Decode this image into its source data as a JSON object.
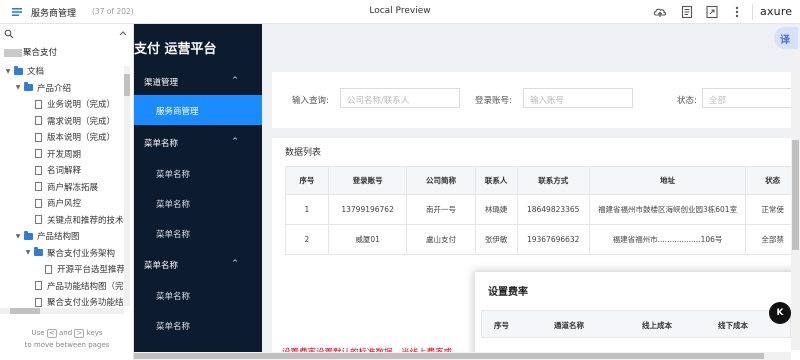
{
  "topbar": {
    "page_title": "服务商管理",
    "page_count": "(37 of 202)",
    "center_title": "Local Preview",
    "brand": "axure",
    "icons": [
      "menu-icon",
      "share-icon",
      "notes-icon",
      "expand-icon",
      "more-icon"
    ]
  },
  "sitemap": {
    "root_label": "聚合支付",
    "rows": [
      {
        "label": "文档",
        "type": "folder",
        "indent": 0,
        "open": true
      },
      {
        "label": "产品介绍",
        "type": "folder",
        "indent": 1,
        "open": true
      },
      {
        "label": "业务说明（完成）",
        "type": "page",
        "indent": 2
      },
      {
        "label": "需求说明（完成）",
        "type": "page",
        "indent": 2
      },
      {
        "label": "版本说明（完成）",
        "type": "page",
        "indent": 2
      },
      {
        "label": "开发周期",
        "type": "page",
        "indent": 2
      },
      {
        "label": "名词解释",
        "type": "page",
        "indent": 2
      },
      {
        "label": "商户解冻拓展",
        "type": "page",
        "indent": 2
      },
      {
        "label": "商户风控",
        "type": "page",
        "indent": 2
      },
      {
        "label": "关键点和推荐的技术",
        "type": "page",
        "indent": 2
      },
      {
        "label": "产品结构图",
        "type": "folder",
        "indent": 1,
        "open": true
      },
      {
        "label": "聚合支付业务架构",
        "type": "folder",
        "indent": 2,
        "open": true
      },
      {
        "label": "开源平台选型推荐",
        "type": "page",
        "indent": 3
      },
      {
        "label": "产品功能结构图（完",
        "type": "page",
        "indent": 2
      },
      {
        "label": "聚合支付业务功能结",
        "type": "page",
        "indent": 2
      }
    ],
    "help_line1_a": "Use",
    "help_key_left": "<",
    "help_line1_b": "and",
    "help_key_right": ">",
    "help_line1_c": "keys",
    "help_line2": "to move between pages"
  },
  "nav": {
    "app_title": "支付 运营平台",
    "groups": [
      {
        "label": "渠道管理",
        "caret": "^"
      },
      {
        "label": "菜单名称",
        "caret": "^"
      },
      {
        "label": "菜单名称",
        "caret": "^"
      }
    ],
    "active_item": "服务商管理",
    "items_group2": [
      "菜单名称",
      "菜单名称",
      "菜单名称"
    ],
    "items_group3": [
      "菜单名称",
      "菜单名称"
    ]
  },
  "filter": {
    "query_label": "输入查询:",
    "query_placeholder": "公司名称/联系人",
    "account_label": "登录账号:",
    "account_placeholder": "输入账号",
    "status_label": "状态:",
    "status_value": "全部"
  },
  "list": {
    "title": "数据列表",
    "columns": [
      "序号",
      "登录账号",
      "公司简称",
      "联系人",
      "联系方式",
      "地址",
      "状态"
    ],
    "rows": [
      [
        "1",
        "13799196762",
        "南开一号",
        "林璐婕",
        "18649823365",
        "福建省福州市鼓楼区海峡创业园3栋601室",
        "正常使"
      ],
      [
        "2",
        "威厦01",
        "盧山支付",
        "张伊敏",
        "19367696632",
        "福建省福州市..................106号",
        "全部禁"
      ]
    ]
  },
  "modal": {
    "title": "设置费率",
    "columns": [
      "序号",
      "通道名称",
      "线上成本",
      "线下成本"
    ]
  },
  "red_note": "设置费率设置默认的标准数据，当线上费率或",
  "floats": {
    "translate_label": "译",
    "k_label": "K"
  },
  "colors": {
    "nav_bg": "#0d1b2e",
    "nav_active": "#1b8cff",
    "note_red": "#e60012",
    "folder_blue": "#2f7fd1"
  }
}
